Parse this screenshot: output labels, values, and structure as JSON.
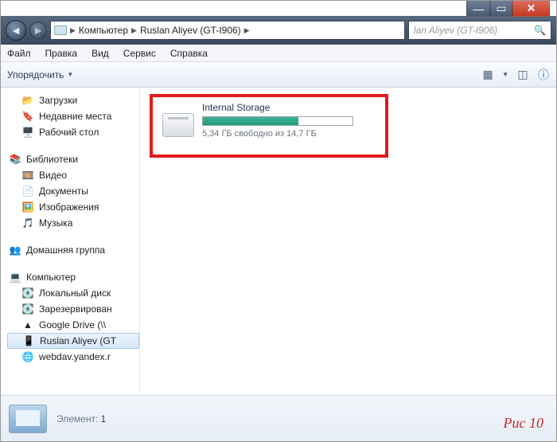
{
  "title_controls": {
    "min": "—",
    "max": "▭",
    "close": "✕"
  },
  "breadcrumb": {
    "root": "Компьютер",
    "device": "Ruslan Aliyev (GT-I906)"
  },
  "search": {
    "placeholder": "lan Aliyev (GT-I906)"
  },
  "menu": {
    "file": "Файл",
    "edit": "Правка",
    "view": "Вид",
    "tools": "Сервис",
    "help": "Справка"
  },
  "toolbar": {
    "organize": "Упорядочить"
  },
  "tree": {
    "fav": {
      "downloads": "Загрузки",
      "recent": "Недавние места",
      "desktop": "Рабочий стол"
    },
    "lib": {
      "label": "Библиотеки",
      "video": "Видео",
      "docs": "Документы",
      "pics": "Изображения",
      "music": "Музыка"
    },
    "homegroup": "Домашняя группа",
    "computer": {
      "label": "Компьютер",
      "local": "Локальный диск",
      "backup": "Зарезервирован",
      "gdrive": "Google Drive (\\\\",
      "device": "Ruslan Aliyev (GT",
      "webdav": "webdav.yandex.r"
    }
  },
  "storage": {
    "title": "Internal Storage",
    "subtitle": "5,34 ГБ свободно из 14,7 ГБ",
    "fill_percent": 64
  },
  "status": {
    "label": "Элемент:",
    "count": "1"
  },
  "caption": "Рис 10"
}
